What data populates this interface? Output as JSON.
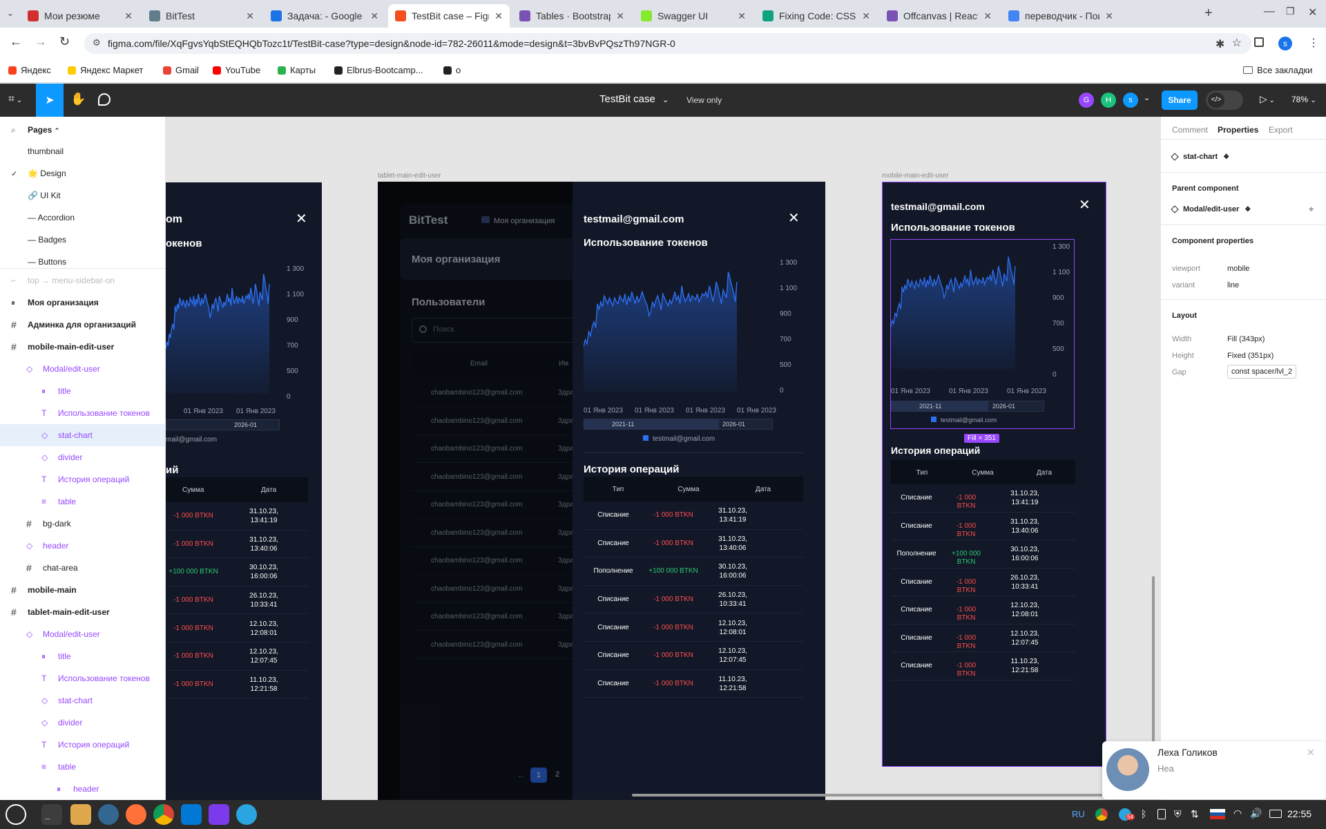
{
  "browser": {
    "tabs": [
      {
        "title": "Мои резюме",
        "color": "#d32f2f",
        "active": false
      },
      {
        "title": "BitTest",
        "color": "#607d8b",
        "active": false
      },
      {
        "title": "Задача: - Google Д",
        "color": "#1a73e8",
        "active": false
      },
      {
        "title": "TestBit case – Figma",
        "color": "#f24e1e",
        "active": true
      },
      {
        "title": "Tables · Bootstrap v",
        "color": "#7952b3",
        "active": false
      },
      {
        "title": "Swagger UI",
        "color": "#85ea2d",
        "active": false
      },
      {
        "title": "Fixing Code: CSS Iss",
        "color": "#10a37f",
        "active": false
      },
      {
        "title": "Offcanvas | React B",
        "color": "#7952b3",
        "active": false
      },
      {
        "title": "переводчик - Поис",
        "color": "#4285f4",
        "active": false
      }
    ],
    "url": "figma.com/file/XqFgvsYqbStEQHQbTozc1t/TestBit-case?type=design&node-id=782-26011&mode=design&t=3bvBvPQszTh97NGR-0",
    "bookmarks": [
      "Яндекс",
      "Яндекс Маркет",
      "Gmail",
      "YouTube",
      "Карты",
      "Elbrus-Bootcamp...",
      "o"
    ],
    "all_bookmarks": "Все закладки",
    "profile_initial": "s"
  },
  "figma": {
    "file_title": "TestBit case",
    "view_mode": "View only",
    "avatars": [
      {
        "initial": "G",
        "color": "#9747ff"
      },
      {
        "initial": "H",
        "color": "#1bc47d"
      },
      {
        "initial": "s",
        "color": "#0d99ff"
      }
    ],
    "share_label": "Share",
    "zoom": "78%"
  },
  "layers": {
    "pages_label": "Pages",
    "pages": [
      "thumbnail",
      "🌟 Design",
      "🔗 UI Kit",
      "— Accordion",
      "— Badges",
      "— Buttons"
    ],
    "items": [
      {
        "label": "top → menu-sidebar-on",
        "kind": "dim",
        "indent": 0
      },
      {
        "label": "Моя организация",
        "kind": "bars",
        "indent": 0
      },
      {
        "label": "Админка для организаций",
        "kind": "hash",
        "indent": 0
      },
      {
        "label": "mobile-main-edit-user",
        "kind": "hash",
        "indent": 0
      },
      {
        "label": "Modal/edit-user",
        "kind": "comp",
        "indent": 1
      },
      {
        "label": "title",
        "kind": "bars",
        "indent": 2
      },
      {
        "label": "Использование токенов",
        "kind": "text",
        "indent": 2
      },
      {
        "label": "stat-chart",
        "kind": "comp",
        "indent": 2,
        "selected": true
      },
      {
        "label": "divider",
        "kind": "comp",
        "indent": 2
      },
      {
        "label": "История операций",
        "kind": "text",
        "indent": 2
      },
      {
        "label": "table",
        "kind": "list",
        "indent": 2
      },
      {
        "label": "bg-dark",
        "kind": "hash",
        "indent": 1
      },
      {
        "label": "header",
        "kind": "comp",
        "indent": 1
      },
      {
        "label": "chat-area",
        "kind": "hash",
        "indent": 1
      },
      {
        "label": "mobile-main",
        "kind": "hash",
        "indent": 0
      },
      {
        "label": "tablet-main-edit-user",
        "kind": "hash",
        "indent": 0
      },
      {
        "label": "Modal/edit-user",
        "kind": "comp",
        "indent": 1
      },
      {
        "label": "title",
        "kind": "bars",
        "indent": 2
      },
      {
        "label": "Использование токенов",
        "kind": "text",
        "indent": 2
      },
      {
        "label": "stat-chart",
        "kind": "comp",
        "indent": 2
      },
      {
        "label": "divider",
        "kind": "comp",
        "indent": 2
      },
      {
        "label": "История операций",
        "kind": "text",
        "indent": 2
      },
      {
        "label": "table",
        "kind": "list",
        "indent": 2
      },
      {
        "label": "header",
        "kind": "bars",
        "indent": 3
      }
    ]
  },
  "properties": {
    "tabs": [
      "Comment",
      "Properties",
      "Export"
    ],
    "component_name": "stat-chart",
    "parent_label": "Parent component",
    "parent_name": "Modal/edit-user",
    "comp_props_label": "Component properties",
    "props": [
      {
        "k": "viewport",
        "v": "mobile"
      },
      {
        "k": "variant",
        "v": "line"
      }
    ],
    "layout_label": "Layout",
    "layout": [
      {
        "k": "Width",
        "v": "Fill (343px)"
      },
      {
        "k": "Height",
        "v": "Fixed (351px)"
      },
      {
        "k": "Gap",
        "v": "const spacer/lvl_2"
      }
    ]
  },
  "canvas": {
    "tablet_frame_label": "tablet-main-edit-user",
    "mobile_frame_label": "mobile-main-edit-user",
    "fill_badge": "Fill × 351",
    "bg_app": {
      "brand": "BitTest",
      "org_tag": "Моя организация",
      "org_title": "Моя организация",
      "users_title": "Пользователи",
      "search_placeholder": "Поиск",
      "col_email": "Email",
      "col_name": "Им",
      "row_email": "chaobambino123@gmail.com",
      "row_name": "Здра",
      "page_current": "1",
      "page_next": "2"
    },
    "modal": {
      "email": "testmail@gmail.com",
      "tokens_title": "Использование токенов",
      "history_title": "История операций",
      "legend": "testmail@gmail.com",
      "range_start": "2021-11",
      "range_end": "2026-01",
      "cols": [
        "Тип",
        "Сумма",
        "Дата"
      ],
      "rows": [
        {
          "type": "Списание",
          "amount": "-1 000 BTKN",
          "date": "31.10.23, 13:41:19",
          "sign": "neg"
        },
        {
          "type": "Списание",
          "amount": "-1 000 BTKN",
          "date": "31.10.23, 13:40:06",
          "sign": "neg"
        },
        {
          "type": "Пополнение",
          "amount": "+100 000 BTKN",
          "date": "30.10.23, 16:00:06",
          "sign": "pos"
        },
        {
          "type": "Списание",
          "amount": "-1 000 BTKN",
          "date": "26.10.23, 10:33:41",
          "sign": "neg"
        },
        {
          "type": "Списание",
          "amount": "-1 000 BTKN",
          "date": "12.10.23, 12:08:01",
          "sign": "neg"
        },
        {
          "type": "Списание",
          "amount": "-1 000 BTKN",
          "date": "12.10.23, 12:07:45",
          "sign": "neg"
        },
        {
          "type": "Списание",
          "amount": "-1 000 BTKN",
          "date": "11.10.23, 12:21:58",
          "sign": "neg"
        }
      ],
      "partial_title_1": "om",
      "partial_title_2": "окенов",
      "partial_title_3": "ий",
      "partial_email": "mail@gmail.com",
      "partial_col_amount": "Сумма",
      "partial_col_date": "Дата"
    }
  },
  "chart_data": {
    "type": "line",
    "title": "",
    "xlabel": "",
    "ylabel": "",
    "x_ticks": [
      "01 Янв 2023",
      "01 Янв 2023",
      "01 Янв 2023",
      "01 Янв 2023"
    ],
    "y_ticks": [
      "0",
      "500",
      "700",
      "900",
      "1 100",
      "1 300"
    ],
    "ylim": [
      0,
      1300
    ],
    "series": [
      {
        "name": "testmail@gmail.com",
        "color": "#2d6ff0",
        "values": [
          450,
          520,
          480,
          600,
          560,
          650,
          700,
          640,
          880,
          820,
          900,
          850,
          960,
          920,
          880,
          940,
          900,
          860,
          940,
          900,
          880,
          960,
          930,
          900,
          980,
          870,
          950,
          900,
          1000,
          940,
          880,
          960,
          900,
          940,
          1000,
          950,
          900,
          860,
          760,
          800,
          900,
          850,
          920,
          960,
          900,
          820,
          980,
          940,
          900,
          860,
          920,
          880,
          940,
          1000,
          920,
          960,
          880,
          1060,
          960,
          900,
          940,
          980,
          900,
          960,
          940,
          920,
          980,
          900,
          940,
          980,
          960,
          1000,
          940,
          1060,
          1000,
          900,
          980,
          1100,
          1040,
          960,
          880,
          1020,
          980,
          940,
          1200,
          1140,
          1060,
          1000,
          900,
          1100
        ]
      }
    ]
  },
  "chat_popup": {
    "name": "Леха Голиков",
    "message": "Неа"
  },
  "taskbar": {
    "lang": "RU",
    "time": "22:55",
    "badge": "54"
  }
}
